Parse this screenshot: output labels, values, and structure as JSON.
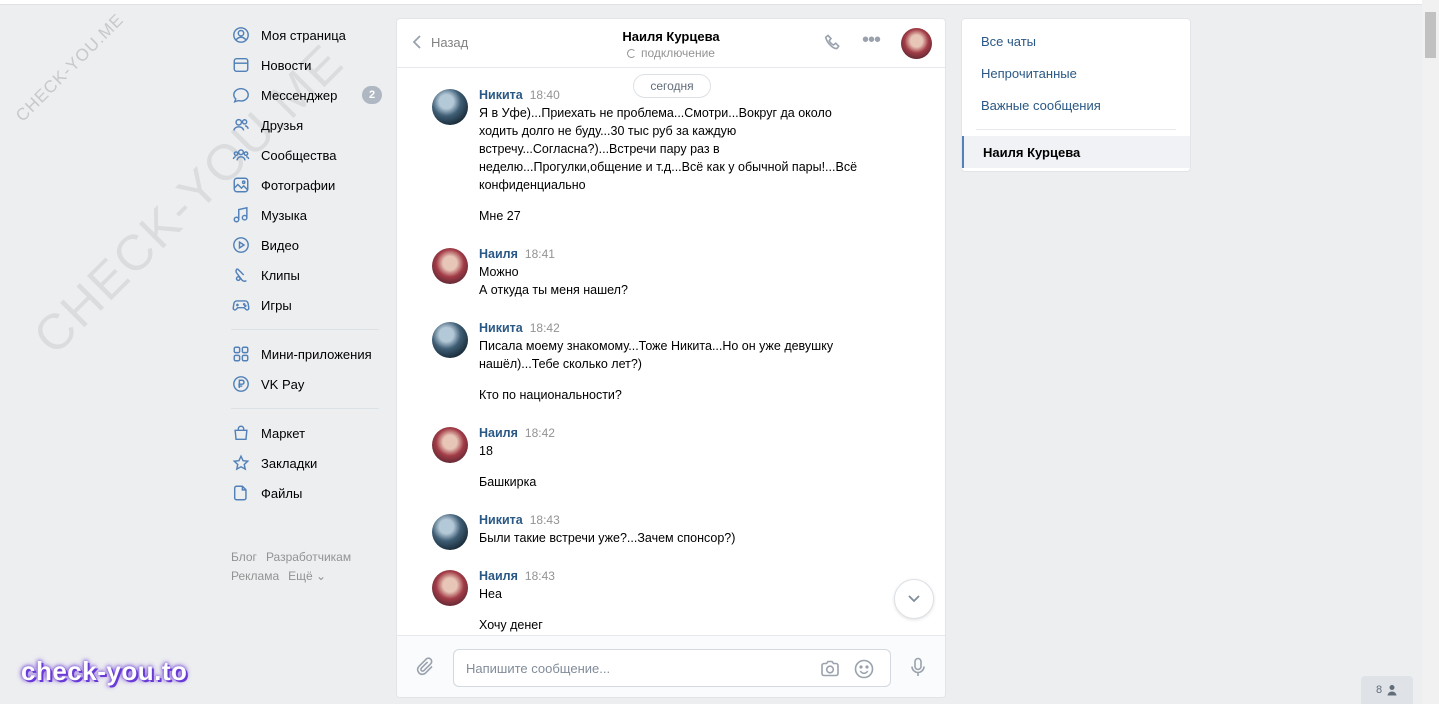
{
  "watermark": {
    "small": "CHECK-YOU.ME",
    "big": "CHECK-YOU.ME",
    "brand": "check-you.to"
  },
  "nav": {
    "items": [
      {
        "label": "Моя страница",
        "icon": "user-circle-icon"
      },
      {
        "label": "Новости",
        "icon": "newspaper-icon"
      },
      {
        "label": "Мессенджер",
        "icon": "message-icon",
        "badge": "2"
      },
      {
        "label": "Друзья",
        "icon": "friends-icon"
      },
      {
        "label": "Сообщества",
        "icon": "communities-icon"
      },
      {
        "label": "Фотографии",
        "icon": "photo-icon"
      },
      {
        "label": "Музыка",
        "icon": "music-icon"
      },
      {
        "label": "Видео",
        "icon": "video-icon"
      },
      {
        "label": "Клипы",
        "icon": "clips-icon"
      },
      {
        "label": "Игры",
        "icon": "gamepad-icon"
      }
    ],
    "items2": [
      {
        "label": "Мини-приложения",
        "icon": "apps-icon"
      },
      {
        "label": "VK Pay",
        "icon": "ruble-icon"
      }
    ],
    "items3": [
      {
        "label": "Маркет",
        "icon": "bag-icon"
      },
      {
        "label": "Закладки",
        "icon": "star-icon"
      },
      {
        "label": "Файлы",
        "icon": "file-icon"
      }
    ],
    "footer": {
      "blog": "Блог",
      "devs": "Разработчикам",
      "ads": "Реклама",
      "more": "Ещё ⌄"
    }
  },
  "chat": {
    "back": "Назад",
    "peer_name": "Наиля Курцева",
    "peer_status": "подключение",
    "date": "сегодня",
    "messages": [
      {
        "author": "Никита",
        "time": "18:40",
        "lines": [
          "Я в Уфе)...Приехать не проблема...Смотри...Вокруг да около ходить долго не буду...30 тыс руб за каждую встречу...Согласна?)...Встречи пару раз в неделю...Прогулки,общение и т.д...Всё как у обычной пары!...Всё конфиденциально",
          "Мне 27"
        ]
      },
      {
        "author": "Наиля",
        "time": "18:41",
        "lines": [
          "Можно\nА откуда ты меня нашел?"
        ]
      },
      {
        "author": "Никита",
        "time": "18:42",
        "lines": [
          "Писала моему знакомому...Тоже Никита...Но он уже девушку нашёл)...Тебе сколько лет?)",
          "Кто по национальности?"
        ]
      },
      {
        "author": "Наиля",
        "time": "18:42",
        "lines": [
          "18",
          "Башкирка"
        ]
      },
      {
        "author": "Никита",
        "time": "18:43",
        "lines": [
          "Были такие встречи уже?...Зачем спонсор?)"
        ]
      },
      {
        "author": "Наиля",
        "time": "18:43",
        "lines": [
          "Неа",
          "Хочу денег"
        ]
      }
    ],
    "composer_placeholder": "Напишите сообщение..."
  },
  "right_panel": {
    "all": "Все чаты",
    "unread": "Непрочитанные",
    "important": "Важные сообщения",
    "active_chat": "Наиля Курцева"
  },
  "people_count": "8"
}
